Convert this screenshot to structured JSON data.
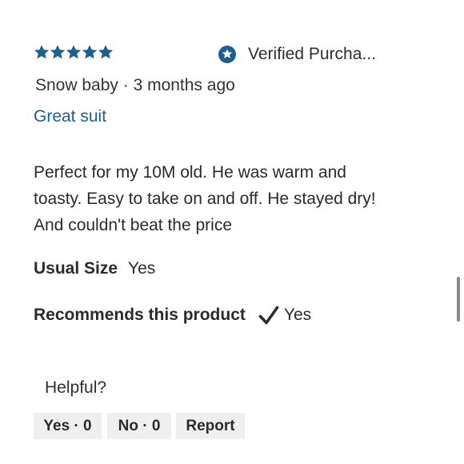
{
  "review": {
    "rating": 5,
    "rating_max": 5,
    "star_color": "#1f5f8f",
    "verified_label": "Verified Purcha...",
    "author_line": "Snow baby · 3 months ago",
    "title": "Great suit",
    "body": "Perfect for my 10M old. He was warm and toasty. Easy to take on and off. He stayed dry! And couldn't beat the price",
    "usual_size": {
      "label": "Usual Size",
      "value": "Yes"
    },
    "recommends": {
      "label": "Recommends this product",
      "value": "Yes",
      "icon": "checkmark-icon"
    }
  },
  "feedback": {
    "prompt": "Helpful?",
    "yes_label": "Yes · 0",
    "no_label": "No · 0",
    "report_label": "Report"
  }
}
